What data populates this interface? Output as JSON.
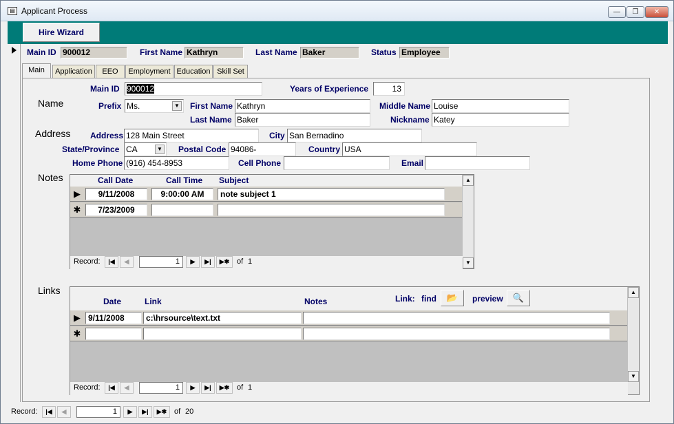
{
  "window": {
    "title": "Applicant Process",
    "minimize": "—",
    "restore": "❐",
    "close": "✕"
  },
  "header": {
    "hire_wizard": "Hire Wizard"
  },
  "summary": {
    "main_id_label": "Main ID",
    "main_id": "900012",
    "first_name_label": "First Name",
    "first_name": "Kathryn",
    "last_name_label": "Last Name",
    "last_name": "Baker",
    "status_label": "Status",
    "status": "Employee"
  },
  "tabs": [
    "Main",
    "Application",
    "EEO",
    "Employment",
    "Education",
    "Skill Set"
  ],
  "main": {
    "main_id_label": "Main ID",
    "main_id": "900012",
    "years_label": "Years of Experience",
    "years": "13",
    "name_section": "Name",
    "prefix_label": "Prefix",
    "prefix": "Ms.",
    "first_name_label": "First Name",
    "first_name": "Kathryn",
    "middle_name_label": "Middle Name",
    "middle_name": "Louise",
    "last_name_label": "Last Name",
    "last_name": "Baker",
    "nickname_label": "Nickname",
    "nickname": "Katey",
    "address_section": "Address",
    "address_label": "Address",
    "address": "128 Main Street",
    "city_label": "City",
    "city": "San Bernadino",
    "state_label": "State/Province",
    "state": "CA",
    "postal_label": "Postal Code",
    "postal": "94086-",
    "country_label": "Country",
    "country": "USA",
    "home_phone_label": "Home Phone",
    "home_phone": "(916) 454-8953",
    "cell_phone_label": "Cell Phone",
    "cell_phone": "",
    "email_label": "Email",
    "email": ""
  },
  "notes": {
    "section": "Notes",
    "headers": {
      "call_date": "Call Date",
      "call_time": "Call Time",
      "subject": "Subject"
    },
    "rows": [
      {
        "marker": "▶",
        "call_date": "9/11/2008",
        "call_time": "9:00:00 AM",
        "subject": "note subject 1"
      },
      {
        "marker": "✱",
        "call_date": "7/23/2009",
        "call_time": "",
        "subject": ""
      }
    ],
    "nav": {
      "label": "Record:",
      "current": "1",
      "of": "of",
      "total": "1"
    }
  },
  "links": {
    "section": "Links",
    "headers": {
      "date": "Date",
      "link": "Link",
      "notes": "Notes"
    },
    "toolbar": {
      "link_label": "Link:",
      "find_label": "find",
      "preview_label": "preview",
      "folder_icon": "📂",
      "preview_icon": "🔍"
    },
    "rows": [
      {
        "marker": "▶",
        "date": "9/11/2008",
        "link": "c:\\hrsource\\text.txt",
        "notes": ""
      },
      {
        "marker": "✱",
        "date": "",
        "link": "",
        "notes": ""
      }
    ],
    "nav": {
      "label": "Record:",
      "current": "1",
      "of": "of",
      "total": "1"
    }
  },
  "main_nav": {
    "label": "Record:",
    "current": "1",
    "of": "of",
    "total": "20"
  },
  "nav_glyphs": {
    "first": "|◀",
    "prev": "◀",
    "next": "▶",
    "last": "▶|",
    "new": "▶✱",
    "up": "▲",
    "down": "▼",
    "dropdown": "▼"
  },
  "colors": {
    "header_band": "#007b78",
    "label": "#000066"
  }
}
